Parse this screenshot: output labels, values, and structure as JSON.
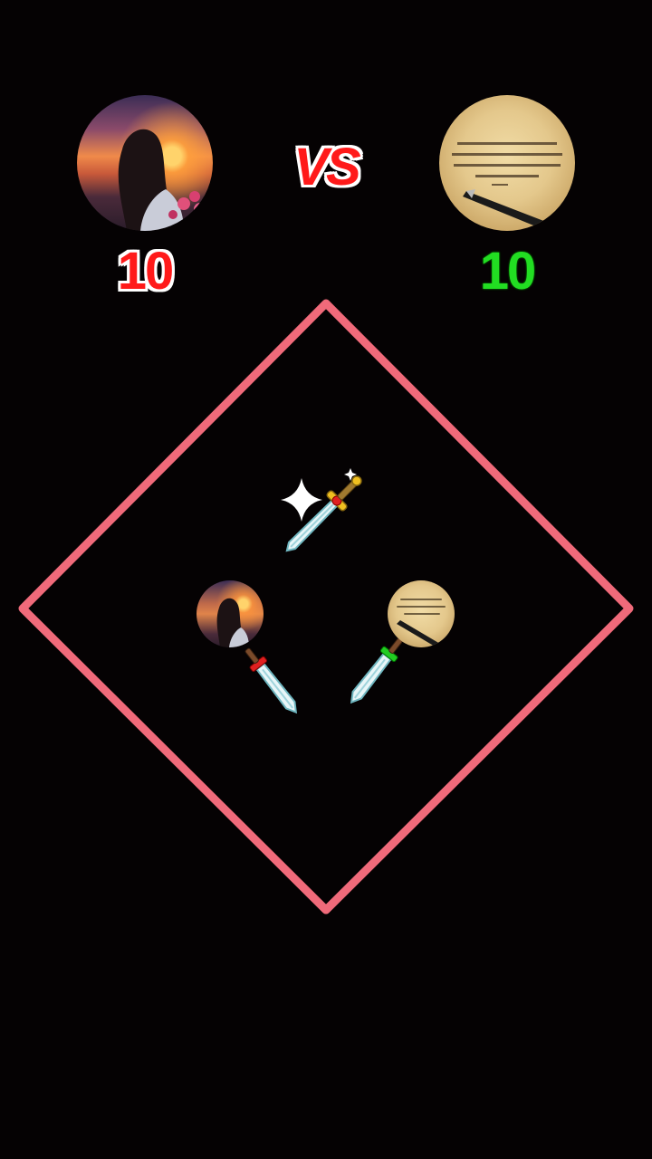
{
  "players": {
    "left": {
      "score": "10",
      "score_color": "#ff1a1a",
      "avatar_icon": "girl-sunset-avatar"
    },
    "right": {
      "score": "10",
      "score_color": "#22dd22",
      "avatar_icon": "paper-pen-avatar"
    }
  },
  "vs_label": "VS",
  "arena": {
    "shape": "diamond",
    "border_color": "#f06a7a"
  },
  "weapons": [
    "sword-icon",
    "sword-icon",
    "sword-icon"
  ],
  "colors": {
    "background": "#050203",
    "accent_red": "#ff1a1a",
    "accent_green": "#22dd22"
  }
}
